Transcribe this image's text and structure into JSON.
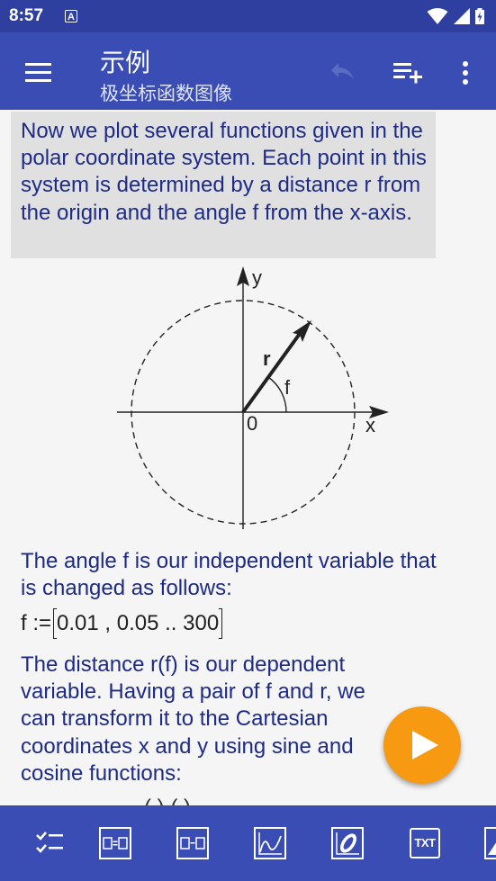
{
  "status_bar": {
    "time": "8:57",
    "notification_letter": "A"
  },
  "app_bar": {
    "title": "示例",
    "subtitle": "极坐标函数图像"
  },
  "content": {
    "intro": "Now we plot several functions given in the polar coordinate system. Each point in this system is determined by a distance r from the origin and the angle f from the x-axis.",
    "diagram": {
      "axis_y_label": "y",
      "axis_x_label": "x",
      "origin_label": "0",
      "radius_label": "r",
      "angle_label": "f"
    },
    "para_angle": "The angle f is our independent variable that is changed as follows:",
    "formula": {
      "lhs": "f :=",
      "value": "0.01 , 0.05 .. 300"
    },
    "para_distance": "The distance r(f) is our dependent variable. Having a pair of f and r, we can transform it to the Cartesian coordinates x and y using sine and cosine functions:",
    "cutoff_text": "(  )                           (  )"
  },
  "colors": {
    "status_bar": "#2e3f9f",
    "app_bar": "#3a4db4",
    "text_blue": "#1e2b86",
    "intro_background": "#e0e0e0",
    "fab": "#f79a12"
  },
  "icons": {
    "menu": "hamburger-icon",
    "undo": "undo-icon",
    "add_list": "playlist-add-icon",
    "more": "more-vert-icon",
    "fab": "play-icon",
    "bottom_bar": [
      "checklist-icon",
      "equation-icon",
      "equation-result-icon",
      "function-plot-icon",
      "polar-plot-icon",
      "text-icon",
      "image-icon"
    ]
  },
  "bottom_bar": {
    "txt_label": "TXT"
  }
}
